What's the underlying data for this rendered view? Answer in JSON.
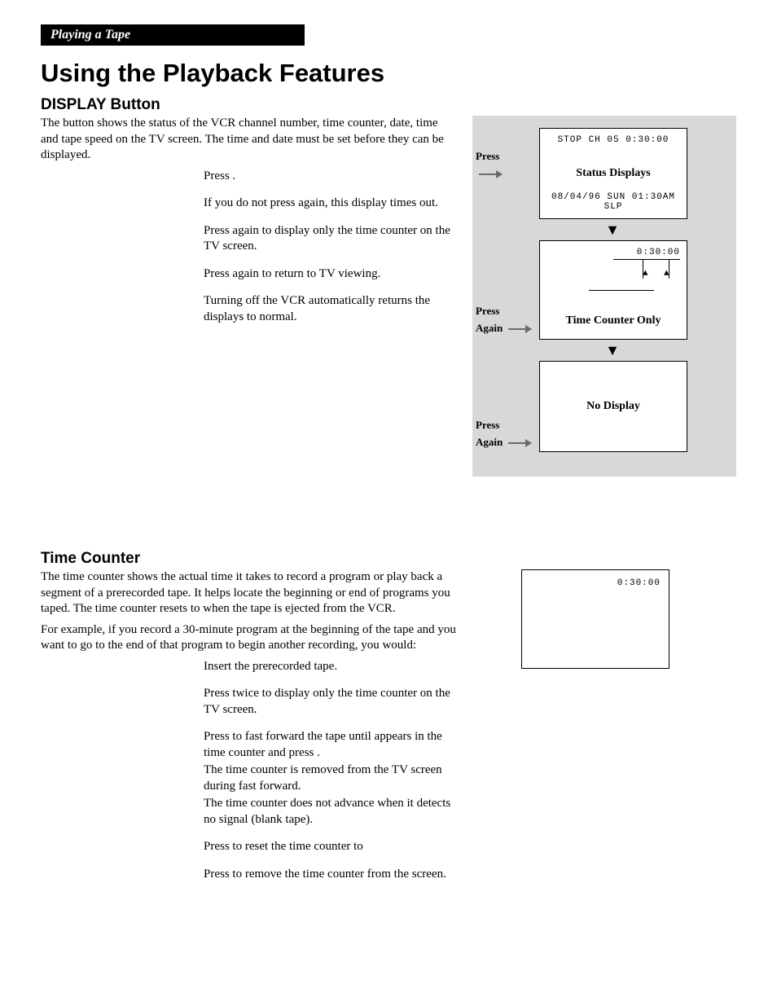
{
  "tab": "Playing a Tape",
  "h1": "Using the Playback Features",
  "s1": {
    "h": "DISPLAY Button",
    "intro": "The               button shows the status of the VCR channel number, time counter, date, time and tape speed on the TV screen. The time and date must be set before they can be displayed.",
    "p1": "Press                .",
    "p2": "If you do not press                again, this display times out.",
    "p3": "Press                again to display only the time counter on the TV screen.",
    "p4": "Press                again to return to TV viewing.",
    "p5": "Turning off the VCR automatically returns the displays to normal."
  },
  "fig": {
    "press": "Press",
    "again": "Again",
    "scr1_top": "STOP  CH 05  0:30:00",
    "scr1_mid": "Status Displays",
    "scr1_bot": "08/04/96 SUN 01:30AM SLP",
    "scr2_tr": "0:30:00",
    "scr2_mid": "Time Counter Only",
    "scr3_mid": "No Display"
  },
  "s2": {
    "h": "Time Counter",
    "intro": "The time counter shows the actual time it takes to record a program or play back a segment of a prerecorded tape. It helps locate the beginning or end of programs you taped. The time counter resets to            when the tape is ejected from the VCR.",
    "ex": "For example, if you record a 30-minute program at the beginning of the tape and you want to go to the end of that program to begin another recording, you would:",
    "p1": "Insert the prerecorded tape.",
    "p2": "Press                twice to display only the time counter on the TV screen.",
    "p3": "Press       to fast forward the tape until                appears in the time counter and press          .",
    "p4": "The time counter is removed from the TV screen during fast forward.",
    "p5": "The time counter does not advance when it detects no signal (blank tape).",
    "p6": "Press             to reset the time counter to",
    "p7": "Press                to remove the time counter from the screen.",
    "box": "0:30:00"
  }
}
